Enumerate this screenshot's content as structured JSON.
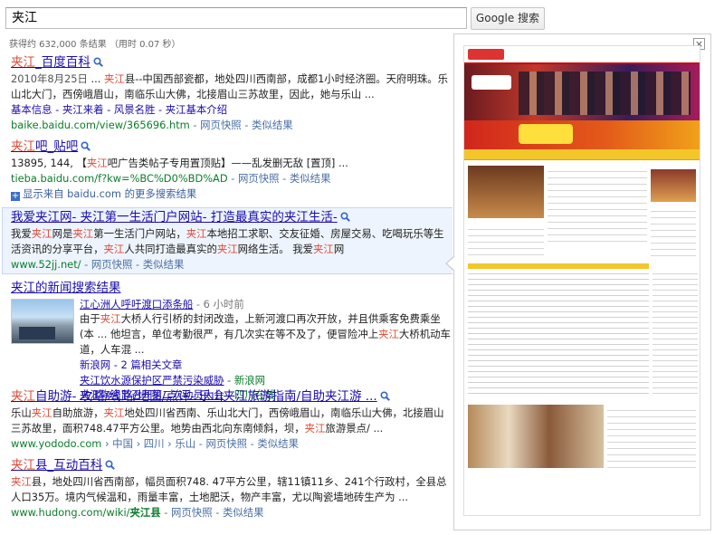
{
  "search": {
    "query": "夹江",
    "button_label": "Google 搜索",
    "stats": "获得约 632,000 条结果 （用时 0.07 秒）"
  },
  "results": [
    {
      "title_hl": "夹江",
      "title_rest": "_百度百科",
      "snippet": [
        {
          "t": "2010年8月25日",
          "c": "dt"
        },
        {
          "t": " ... ",
          "c": ""
        },
        {
          "t": "夹江",
          "c": "hl"
        },
        {
          "t": "县--中国西部瓷都，地处四川西南部，成都1小时经济圈。天府明珠。乐山北大门，西傍峨眉山，南临乐山大佛，北接眉山三苏故里，因此，她与乐山 ...",
          "c": ""
        }
      ],
      "sitelinks": "基本信息 - 夹江来着 - 风景名胜 - 夹江基本介绍",
      "url": "baike.baidu.com/view/365696.htm",
      "url_tail": " - 网页快照 - 类似结果"
    },
    {
      "title_hl": "夹江",
      "title_rest": "吧_贴吧",
      "snippet": [
        {
          "t": "13895, 144, 【",
          "c": ""
        },
        {
          "t": "夹江",
          "c": "hl"
        },
        {
          "t": "吧广告类帖子专用置顶贴】——乱发删无敌 [置顶] ...",
          "c": ""
        }
      ],
      "url": "tieba.baidu.com/f?kw=%BC%D0%BD%AD",
      "url_tail": " - 网页快照 - 类似结果",
      "more_from": "显示来自 baidu.com 的更多搜索结果"
    },
    {
      "title": "我爱夹江网- 夹江第一生活门户网站- 打造最真实的夹江生活-",
      "snippet": [
        {
          "t": "我爱",
          "c": ""
        },
        {
          "t": "夹江",
          "c": "hl"
        },
        {
          "t": "网是",
          "c": ""
        },
        {
          "t": "夹江",
          "c": "hl"
        },
        {
          "t": "第一生活门户网站，",
          "c": ""
        },
        {
          "t": "夹江",
          "c": "hl"
        },
        {
          "t": "本地招工求职、交友征婚、房屋交易、吃喝玩乐等生活资讯的分享平台，",
          "c": ""
        },
        {
          "t": "夹江",
          "c": "hl"
        },
        {
          "t": "人共同打造最真实的",
          "c": ""
        },
        {
          "t": "夹江",
          "c": "hl"
        },
        {
          "t": "网络生活。 我爱",
          "c": ""
        },
        {
          "t": "夹江",
          "c": "hl"
        },
        {
          "t": "网",
          "c": ""
        }
      ],
      "url": "www.52jj.net/",
      "url_tail": " - 网页快照 - 类似结果"
    }
  ],
  "news": {
    "title": "夹江的新闻搜索结果",
    "headline": "江心洲人呼吁渡口添条船",
    "ago": " - 6 小时前",
    "snippet": [
      {
        "t": "由于",
        "c": ""
      },
      {
        "t": "夹江",
        "c": "hl"
      },
      {
        "t": "大桥人行引桥的封闭改造，上新河渡口再次开放，并且供乘客免费乘坐 (本 ... 他坦言，单位考勤很严，有几次实在等不及了，便冒险冲上",
        "c": ""
      },
      {
        "t": "夹江",
        "c": "hl"
      },
      {
        "t": "大桥机动车道，人车混 ...",
        "c": ""
      }
    ],
    "source": "新浪网 - 2 篇相关文章",
    "item2": "夹江饮水源保护区严禁污染威胁",
    "item2_src": " - 新浪网",
    "item3": "夹江陶瓷节召开第二次动员大会",
    "item3_src": " - 四川在线"
  },
  "results2": [
    {
      "title_hl": "夹江",
      "title_pre": "",
      "title_rest": "自助游- 攻略/线路/地图/点评- 乐山夹江旅游指南/自助夹江游 ...",
      "snippet": [
        {
          "t": "乐山",
          "c": ""
        },
        {
          "t": "夹江",
          "c": "hl"
        },
        {
          "t": "自助旅游，",
          "c": ""
        },
        {
          "t": "夹江",
          "c": "hl"
        },
        {
          "t": "地处四川省西南、乐山北大门，西傍峨眉山，南临乐山大佛，北接眉山三苏故里，面积748.47平方公里。地势由西北向东南倾斜，坝，",
          "c": ""
        },
        {
          "t": "夹江",
          "c": "hl"
        },
        {
          "t": "旅游景点/ ...",
          "c": ""
        }
      ],
      "url": "www.yododo.com",
      "url_crumbs": " › 中国 › 四川 › 乐山",
      "url_tail": " - 网页快照 - 类似结果"
    },
    {
      "title_hl": "夹江",
      "title_rest": "县_互动百科",
      "snippet": [
        {
          "t": "夹江",
          "c": "hl"
        },
        {
          "t": "县，地处四川省西南部，幅员面积748. 47平方公里，辖11镇11乡、241个行政村，全县总人口35万。境内气候温和，雨量丰富，土地肥沃，物产丰富，尤以陶瓷墙地砖生产为 ...",
          "c": ""
        }
      ],
      "url": "www.hudong.com/wiki/",
      "url_bold": "夹江县",
      "url_tail": " - 网页快照 - 类似结果"
    }
  ],
  "preview": {
    "close_label": "×"
  },
  "colors": {
    "link": "#1a0dab",
    "highlight": "#dd4b39",
    "url": "#0a7e2a",
    "selected_bg": "#eef4fd"
  }
}
